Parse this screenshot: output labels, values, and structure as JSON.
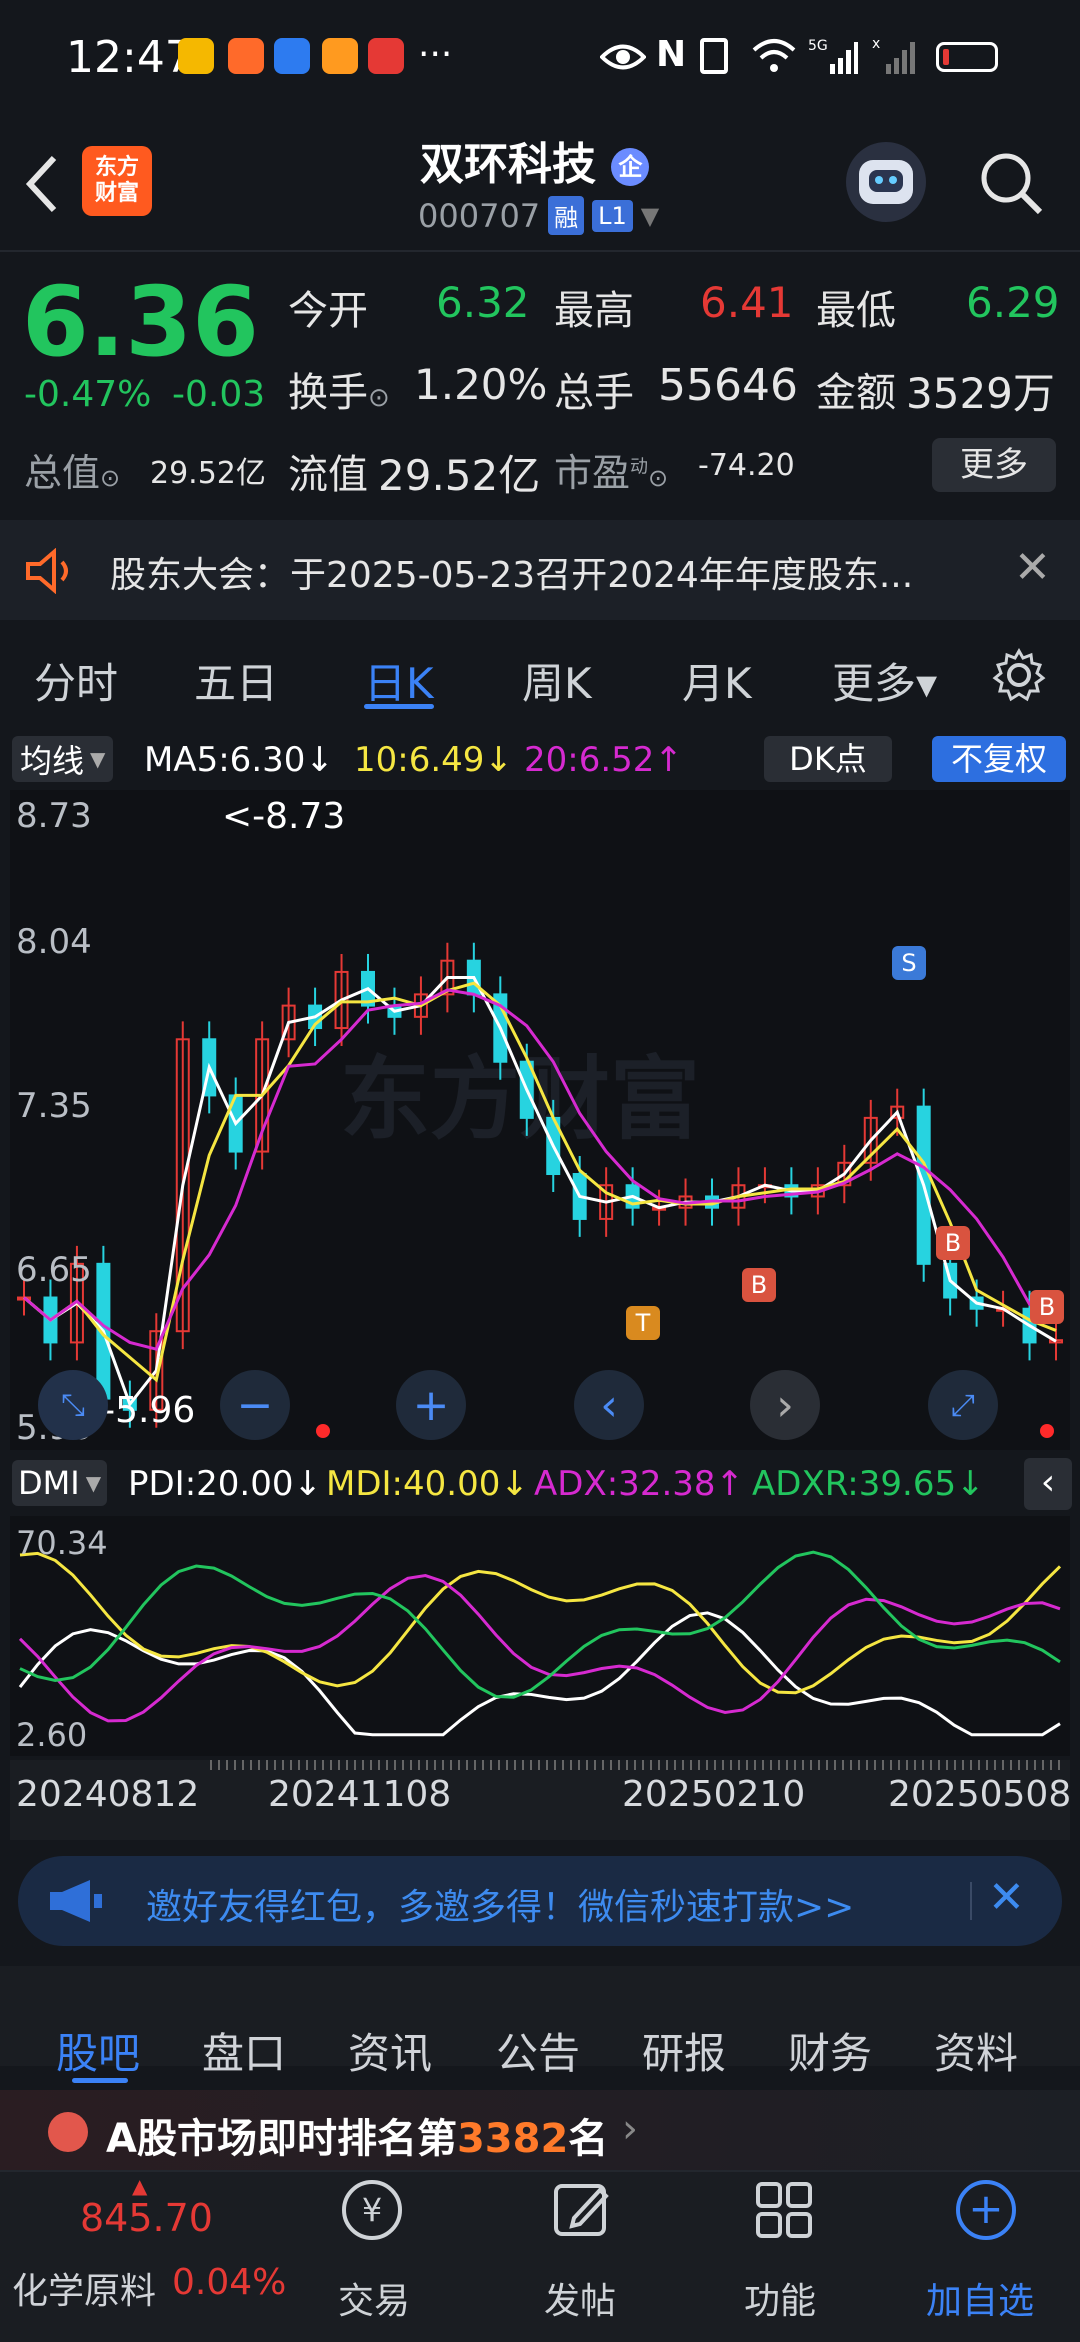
{
  "status_bar": {
    "time": "12:47",
    "dots": "···"
  },
  "header": {
    "logo_text_1": "东方",
    "logo_text_2": "财富",
    "stock_name": "双环科技",
    "badge": "企",
    "code": "000707",
    "tag_margin": "融",
    "tag_level": "L1"
  },
  "quote": {
    "price": "6.36",
    "pct": "-0.47%",
    "chg": "-0.03",
    "open_label": "今开",
    "open": "6.32",
    "high_label": "最高",
    "high": "6.41",
    "low_label": "最低",
    "low": "6.29",
    "turnover_label": "换手",
    "turnover": "1.20%",
    "volume_label": "总手",
    "volume": "55646",
    "amount_label": "金额",
    "amount": "3529万",
    "mktcap_label": "总值",
    "mktcap": "29.52亿",
    "float_label": "流值",
    "float": "29.52亿",
    "pe_label": "市盈",
    "pe_sup": "动",
    "pe": "-74.20",
    "more": "更多"
  },
  "notice": {
    "text": "股东大会：于2025-05-23召开2024年年度股东..."
  },
  "period_tabs": [
    "分时",
    "五日",
    "日K",
    "周K",
    "月K",
    "更多▾"
  ],
  "kline": {
    "ma_selector": "均线",
    "ma5": "MA5:6.30↓",
    "ma10": "10:6.49↓",
    "ma20": "20:6.52↑",
    "dk_button": "DK点",
    "adjust_button": "不复权",
    "y_ticks": [
      "8.73",
      "8.04",
      "7.35",
      "6.65",
      "5.96"
    ],
    "high_note": "<-8.73",
    "low_note": "<-5.96",
    "markers": [
      "S",
      "B",
      "B",
      "B",
      "T"
    ],
    "watermark": "东方财富"
  },
  "dmi": {
    "selector": "DMI",
    "pdi": "PDI:20.00↓",
    "mdi": "MDI:40.00↓",
    "adx": "ADX:32.38↑",
    "adxr": "ADXR:39.65↓",
    "y_top": "70.34",
    "y_bottom": "2.60"
  },
  "x_axis": [
    "20240812",
    "20241108",
    "20250210",
    "20250508"
  ],
  "promo": {
    "text": "邀好友得红包，多邀多得！微信秒速打款>>"
  },
  "content_tabs": [
    "股吧",
    "盘口",
    "资讯",
    "公告",
    "研报",
    "财务",
    "资料"
  ],
  "ranking": {
    "prefix": "A股市场即时排名第",
    "rank": "3382",
    "suffix": "名"
  },
  "bottom_nav": {
    "index_value": "845.70",
    "index_name": "化学原料",
    "index_pct": "0.04%",
    "items": [
      "交易",
      "发帖",
      "功能",
      "加自选"
    ]
  },
  "chart_data": [
    {
      "type": "candlestick",
      "title": "日K",
      "x": [
        "20240812",
        "20241108",
        "20250210",
        "20250508"
      ],
      "ylim": [
        5.96,
        8.73
      ],
      "y_ticks": [
        8.73,
        8.04,
        7.35,
        6.65,
        5.96
      ],
      "approx_close": [
        6.55,
        6.35,
        6.7,
        6.1,
        6.05,
        6.4,
        7.7,
        7.45,
        7.2,
        7.7,
        7.85,
        7.75,
        8.0,
        7.85,
        7.8,
        7.9,
        8.05,
        7.9,
        7.6,
        7.35,
        7.1,
        6.9,
        7.05,
        6.95,
        6.95,
        7.0,
        6.95,
        7.05,
        7.05,
        7.0,
        7.05,
        7.15,
        7.35,
        7.4,
        6.7,
        6.55,
        6.5,
        6.5,
        6.35,
        6.36
      ],
      "series": [
        {
          "name": "MA5",
          "value": 6.3
        },
        {
          "name": "10",
          "value": 6.49
        },
        {
          "name": "20",
          "value": 6.52
        }
      ],
      "high": 8.73,
      "low": 5.96,
      "colors": {
        "up": "#e53935",
        "down": "#27d3e0",
        "ma5": "#ffffff",
        "ma10": "#f5e642",
        "ma20": "#d62ad0"
      }
    },
    {
      "type": "line",
      "title": "DMI",
      "ylim": [
        2.6,
        70.34
      ],
      "series": [
        {
          "name": "PDI",
          "value": 20.0,
          "color": "#ffffff"
        },
        {
          "name": "MDI",
          "value": 40.0,
          "color": "#f5e642"
        },
        {
          "name": "ADX",
          "value": 32.38,
          "color": "#d62ad0"
        },
        {
          "name": "ADXR",
          "value": 39.65,
          "color": "#22c55e"
        }
      ]
    }
  ]
}
